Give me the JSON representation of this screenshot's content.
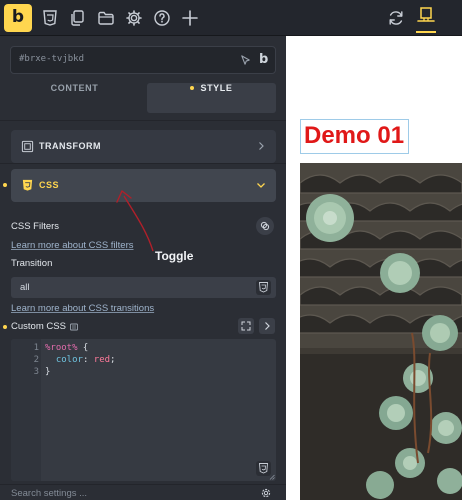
{
  "toolbar": {
    "logo": "b",
    "icons": [
      "css3-icon",
      "pages-icon",
      "folder-icon",
      "settings-icon",
      "help-icon",
      "add-icon",
      "refresh-icon",
      "desktop-breakpoint-icon"
    ]
  },
  "element_id": "#brxe-tvjbkd",
  "id_bar_logo": "b",
  "tabs": {
    "content": "CONTENT",
    "style": "STYLE"
  },
  "sections": {
    "transform": "TRANSFORM",
    "css": "CSS"
  },
  "css_filters": {
    "label": "CSS Filters",
    "link": "Learn more about CSS filters"
  },
  "transition": {
    "label": "Transition",
    "value": "all",
    "link": "Learn more about CSS transitions"
  },
  "custom_css": {
    "label": "Custom CSS",
    "lines": [
      {
        "n": "1",
        "parts": [
          {
            "cls": "tok-sel",
            "t": "%root%"
          },
          {
            "cls": "",
            "t": " {"
          }
        ]
      },
      {
        "n": "2",
        "parts": [
          {
            "cls": "",
            "t": "  "
          },
          {
            "cls": "tok-prop",
            "t": "color"
          },
          {
            "cls": "",
            "t": ": "
          },
          {
            "cls": "tok-val",
            "t": "red"
          },
          {
            "cls": "",
            "t": ";"
          }
        ]
      },
      {
        "n": "3",
        "parts": [
          {
            "cls": "",
            "t": "}"
          }
        ]
      }
    ]
  },
  "search_settings": "Search settings ...",
  "annotation": {
    "label": "Toggle"
  },
  "preview": {
    "heading": "Demo 01"
  },
  "colors": {
    "accent": "#ffd64f",
    "panel": "#2b2e35",
    "heading": "#e01818"
  }
}
